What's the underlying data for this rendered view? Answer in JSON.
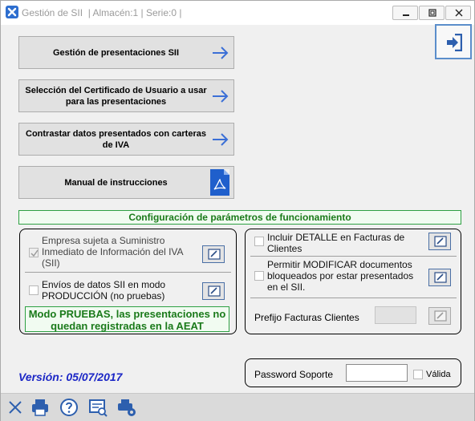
{
  "window": {
    "title": "Gestión de SII",
    "subtitle": "| Almacén:1 | Serie:0 |"
  },
  "menu": {
    "gestion_label": "Gestión de presentaciones SII",
    "certificado_label": "Selección del Certificado de Usuario a usar para las presentaciones",
    "contrastar_label": "Contrastar datos presentados con carteras de IVA",
    "manual_label": "Manual de instrucciones"
  },
  "config": {
    "header": "Configuración de parámetros de funcionamiento",
    "empresa_label": "Empresa sujeta a Suministro Inmediato de Información del IVA (SII)",
    "empresa_checked": true,
    "envios_label": "Envíos de datos SII en modo PRODUCCIÓN (no pruebas)",
    "envios_checked": false,
    "mode_text": "Modo PRUEBAS, las presentaciones no quedan registradas en la AEAT",
    "detalle_label": "Incluir DETALLE en Facturas de Clientes",
    "detalle_checked": false,
    "modificar_label": "Permitir MODIFICAR documentos bloqueados por estar presentados en el SII.",
    "modificar_checked": false,
    "prefijo_label": "Prefijo Facturas Clientes",
    "prefijo_value": ""
  },
  "footer": {
    "version": "Versión:  05/07/2017",
    "password_label": "Password Soporte",
    "password_value": "",
    "valida_label": "Válida",
    "valida_checked": false
  },
  "colors": {
    "accent_green": "#2ea043",
    "version_blue": "#1c27c6",
    "arrow_blue": "#3b6fd6"
  },
  "icons": {
    "app": "app-logo-icon",
    "exit": "exit-door-icon",
    "arrow": "arrow-right-icon",
    "pdf": "pdf-icon",
    "edit": "pencil-edit-icon",
    "toolbar": [
      "close-icon",
      "printer-icon",
      "help-icon",
      "preview-icon",
      "print-settings-icon"
    ]
  }
}
